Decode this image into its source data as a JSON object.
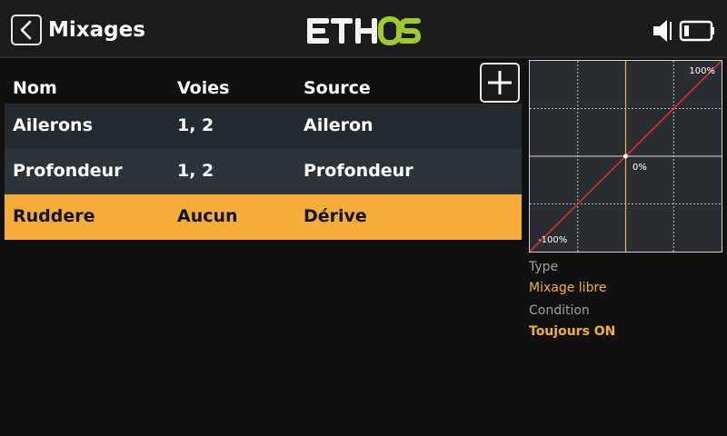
{
  "header": {
    "title": "Mixages",
    "logo_text": "ETHOS",
    "icons": [
      "back-icon",
      "speaker-icon",
      "battery-icon"
    ]
  },
  "table": {
    "columns": [
      "Nom",
      "Voies",
      "Source"
    ],
    "rows": [
      {
        "name": "Ailerons",
        "channels": "1, 2",
        "source": "Aileron"
      },
      {
        "name": "Profondeur",
        "channels": "1, 2",
        "source": "Profondeur"
      },
      {
        "name": "Ruddere",
        "channels": "Aucun",
        "source": "Dérive"
      }
    ],
    "selected_row": 2
  },
  "add_button": {
    "icon": "plus-icon"
  },
  "curve": {
    "max_label": "100%",
    "center_label": "0%",
    "min_label": "-100%",
    "line_color": "#e03030",
    "axis_color": "#f5ad37"
  },
  "details": {
    "type_label": "Type",
    "type_value": "Mixage libre",
    "condition_label": "Condition",
    "condition_value": "Toujours ON"
  },
  "colors": {
    "accent": "#f5ad37",
    "background": "#111111",
    "header": "#1c1c1c"
  }
}
